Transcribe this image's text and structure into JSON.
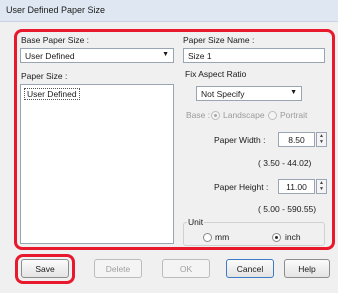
{
  "window": {
    "title": "User Defined Paper Size"
  },
  "base_paper_size": {
    "label": "Base Paper Size :",
    "value": "User Defined"
  },
  "paper_size": {
    "label": "Paper Size :",
    "items": [
      "User Defined"
    ]
  },
  "paper_size_name": {
    "label": "Paper Size Name :",
    "value": "Size 1"
  },
  "fix_aspect_ratio": {
    "label": "Fix Aspect Ratio",
    "value": "Not Specify"
  },
  "base": {
    "label": "Base :",
    "landscape_label": "Landscape",
    "portrait_label": "Portrait",
    "selected": "Landscape"
  },
  "paper_width": {
    "label": "Paper Width :",
    "value": "8.50",
    "range": "( 3.50 - 44.02)"
  },
  "paper_height": {
    "label": "Paper Height :",
    "value": "11.00",
    "range": "( 5.00 - 590.55)"
  },
  "unit": {
    "label": "Unit",
    "mm_label": "mm",
    "inch_label": "inch",
    "selected": "inch"
  },
  "buttons": {
    "save": "Save",
    "delete": "Delete",
    "ok": "OK",
    "cancel": "Cancel",
    "help": "Help"
  },
  "colors": {
    "highlight": "#e8192c",
    "titlebar": "#dfe8f2",
    "dialog_bg": "#f0f0f0"
  },
  "icons": {
    "dropdown": "chevron-down-icon",
    "spin": "spin-arrows-icon"
  }
}
